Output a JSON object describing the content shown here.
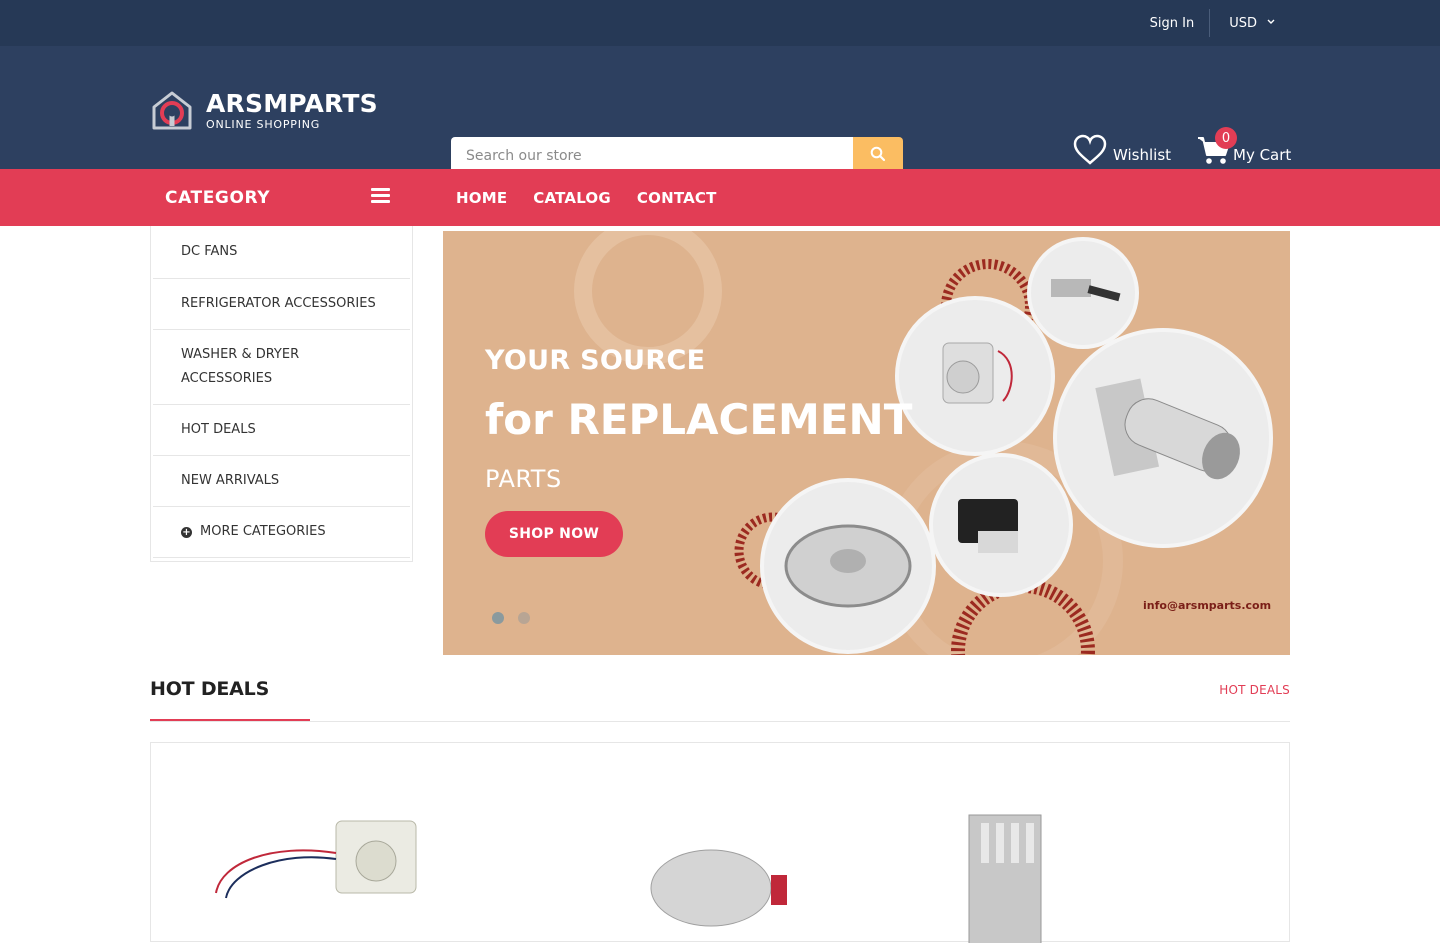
{
  "topbar": {
    "sign_in": "Sign In",
    "currency": "USD"
  },
  "header": {
    "brand": "ARSMPARTS",
    "tagline": "ONLINE SHOPPING",
    "search_placeholder": "Search our store",
    "wishlist_label": "Wishlist",
    "cart_label": "My Cart",
    "cart_count": "0"
  },
  "nav": {
    "category_title": "CATEGORY",
    "menu": [
      "HOME",
      "CATALOG",
      "CONTACT"
    ]
  },
  "sidebar": {
    "items": [
      "DC FANS",
      "REFRIGERATOR ACCESSORIES",
      "WASHER & DRYER ACCESSORIES",
      "HOT DEALS",
      "NEW ARRIVALS"
    ],
    "more": "MORE CATEGORIES"
  },
  "banner": {
    "line1": "YOUR SOURCE",
    "line2": "for REPLACEMENT",
    "line3": "PARTS",
    "button": "SHOP NOW",
    "email": "info@arsmparts.com",
    "slides": 2,
    "active_slide": 1
  },
  "section": {
    "title": "HOT DEALS",
    "link": "HOT DEALS"
  },
  "colors": {
    "topbar": "#263956",
    "header": "#2d4060",
    "accent": "#e23d55",
    "search_button": "#fbbd62",
    "banner_bg": "#deb38e"
  }
}
